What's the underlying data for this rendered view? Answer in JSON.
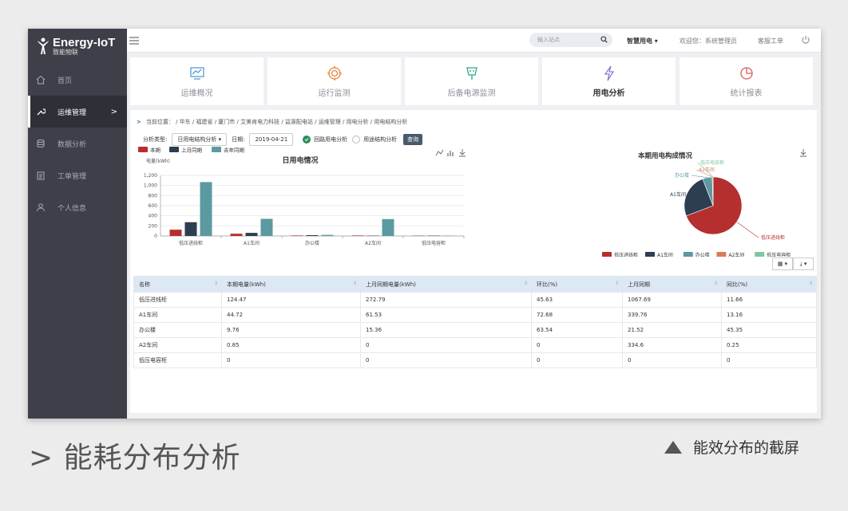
{
  "app": {
    "logo_title": "Energy-IoT",
    "logo_subtitle": "致能物联"
  },
  "sidebar": {
    "items": [
      {
        "label": "首页",
        "icon": "home-icon"
      },
      {
        "label": "运维管理",
        "icon": "wrench-icon",
        "arrow": ">"
      },
      {
        "label": "数据分析",
        "icon": "database-icon"
      },
      {
        "label": "工单管理",
        "icon": "clipboard-icon"
      },
      {
        "label": "个人信息",
        "icon": "user-icon"
      }
    ]
  },
  "topbar": {
    "search_placeholder": "输入站点",
    "menu_label": "智慧用电 ▾",
    "welcome": "欢迎您：系统管理员",
    "support": "客服工单"
  },
  "cards": [
    {
      "label": "运维概况",
      "icon": "monitor-chart-icon"
    },
    {
      "label": "运行监测",
      "icon": "target-icon"
    },
    {
      "label": "后备电源监测",
      "icon": "plug-icon"
    },
    {
      "label": "用电分析",
      "icon": "lightning-icon"
    },
    {
      "label": "统计报表",
      "icon": "pie-icon"
    }
  ],
  "breadcrumb": "当前位置： / 华东 / 福建省 / 厦门市 / 艾美肯电力科技 / 益源配电站 / 运维管理 / 用电分析 / 用电结构分析",
  "filters": {
    "type_label": "分析类型:",
    "type_value": "日用电结构分析 ▾",
    "date_label": "日期:",
    "date_value": "2019-04-21",
    "radio1": "回路用电分析",
    "radio2": "用途结构分析",
    "query_button": "查询"
  },
  "colors": {
    "current": "#b52f2f",
    "last_month": "#2c3e50",
    "last_year": "#5b9aa0",
    "office": "#5b9aa0",
    "a2": "#d97b5a",
    "cap": "#7fc6a4",
    "accent": "#2b6cb0"
  },
  "chart_data": [
    {
      "type": "bar",
      "title": "日用电情况",
      "ylabel": "电量(kWh)",
      "categories": [
        "低压进线柜",
        "A1车间",
        "办公楼",
        "A2车间",
        "低压电容柜"
      ],
      "series": [
        {
          "name": "本期",
          "values": [
            124.47,
            44.72,
            9.76,
            0.85,
            0
          ]
        },
        {
          "name": "上月同期",
          "values": [
            272.79,
            61.53,
            15.36,
            0,
            0
          ]
        },
        {
          "name": "去年同期",
          "values": [
            1067.69,
            339.76,
            21.52,
            334.6,
            0
          ]
        }
      ],
      "ylim": [
        0,
        1200
      ],
      "yticks": [
        "0",
        "200",
        "400",
        "600",
        "800",
        "1,000",
        "1,200"
      ],
      "grid": true,
      "legend": "top-left"
    },
    {
      "type": "pie",
      "title": "本期用电构成情况",
      "labels": [
        "低压进线柜",
        "A1车间",
        "办公楼",
        "A2车间",
        "低压电容柜"
      ],
      "values": [
        124.47,
        44.72,
        9.76,
        0.85,
        0
      ],
      "legend": "bottom"
    }
  ],
  "table": {
    "headers": [
      "名称",
      "本期电量(kWh)",
      "上月同期电量(kWh)",
      "环比(%)",
      "上月同期",
      "同比(%)"
    ],
    "rows": [
      [
        "低压进线柜",
        "124.47",
        "272.79",
        "45.63",
        "1067.69",
        "11.66"
      ],
      [
        "A1车间",
        "44.72",
        "61.53",
        "72.68",
        "339.76",
        "13.16"
      ],
      [
        "办公楼",
        "9.76",
        "15.36",
        "63.54",
        "21.52",
        "45.35"
      ],
      [
        "A2车间",
        "0.85",
        "0",
        "0",
        "334.6",
        "0.25"
      ],
      [
        "低压电容柜",
        "0",
        "0",
        "0",
        "0",
        "0"
      ]
    ],
    "btn_grid": "▦ ▾",
    "btn_export": "⤓ ▾"
  },
  "captions": {
    "left": "> 能耗分布分析",
    "right": "能效分布的截屏"
  }
}
